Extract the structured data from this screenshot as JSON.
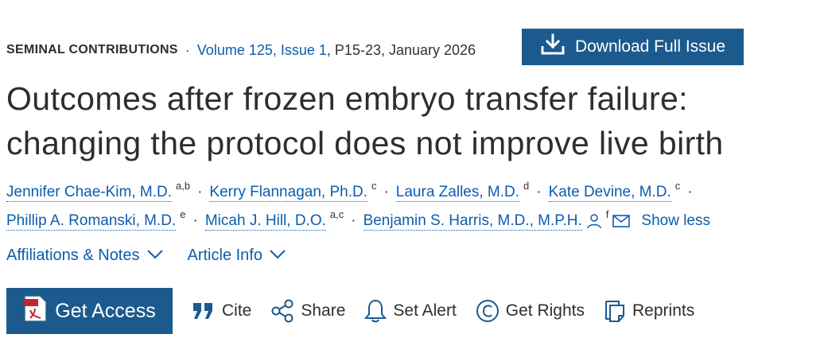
{
  "header": {
    "section": "SEMINAL CONTRIBUTIONS",
    "separator": "·",
    "volume_issue": "Volume 125, Issue 1",
    "pages_date": "P15-23, January 2026",
    "download_label": "Download Full Issue"
  },
  "article": {
    "title": "Outcomes after frozen embryo transfer failure: changing the protocol does not improve live birth"
  },
  "authors": {
    "list": [
      {
        "name": "Jennifer Chae-Kim, M.D.",
        "affiliations": "a,b"
      },
      {
        "name": "Kerry Flannagan, Ph.D.",
        "affiliations": "c"
      },
      {
        "name": "Laura Zalles, M.D.",
        "affiliations": "d"
      },
      {
        "name": "Kate Devine, M.D.",
        "affiliations": "c"
      },
      {
        "name": "Phillip A. Romanski, M.D.",
        "affiliations": "e"
      },
      {
        "name": "Micah J. Hill, D.O.",
        "affiliations": "a,c"
      },
      {
        "name": "Benjamin S. Harris, M.D., M.P.H.",
        "affiliations": "f"
      }
    ],
    "separator": "·",
    "show_less_label": "Show less"
  },
  "toggles": {
    "affiliations_label": "Affiliations & Notes",
    "article_info_label": "Article Info"
  },
  "actions": {
    "get_access_label": "Get Access",
    "cite_label": "Cite",
    "share_label": "Share",
    "set_alert_label": "Set Alert",
    "get_rights_label": "Get Rights",
    "reprints_label": "Reprints"
  },
  "colors": {
    "link": "#0c5db0",
    "button": "#1c5a8e",
    "text": "#2e2e2e"
  }
}
